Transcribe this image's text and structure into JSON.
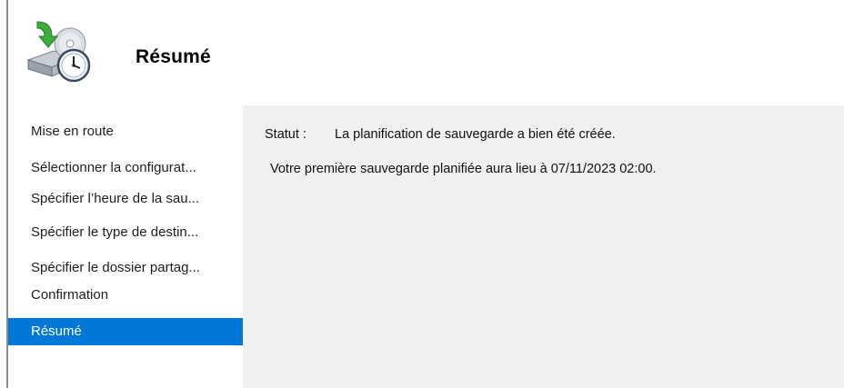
{
  "header": {
    "title": "Résumé",
    "icon": "backup-schedule-icon"
  },
  "sidebar": {
    "items": [
      {
        "label": "Mise en route",
        "active": false
      },
      {
        "label": "Sélectionner la configurat...",
        "active": false
      },
      {
        "label": "Spécifier l’heure de la sau...",
        "active": false
      },
      {
        "label": "Spécifier le type de destin...",
        "active": false
      },
      {
        "label": "Spécifier le dossier partag...",
        "active": false
      },
      {
        "label": "Confirmation",
        "active": false
      },
      {
        "label": "Résumé",
        "active": true
      }
    ],
    "active_color": "#0078d7"
  },
  "main": {
    "status_label": "Statut :",
    "status_value": "La planification de sauvegarde a bien été créée.",
    "next_backup": "Votre première sauvegarde planifiée aura lieu à 07/11/2023 02:00."
  },
  "colors": {
    "content_background": "#f0f0f0"
  }
}
